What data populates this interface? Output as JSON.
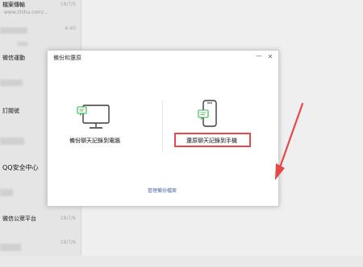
{
  "chat_list": {
    "items": [
      {
        "name": "檔案傳輸",
        "preview": "",
        "time": "18/7/5"
      },
      {
        "name": "",
        "preview": "www.zhihu.com/...",
        "time": ""
      },
      {
        "name": "",
        "preview": "",
        "time": "6:40"
      },
      {
        "name": "微信運動",
        "preview": "",
        "time": "18"
      },
      {
        "name": "",
        "preview": "",
        "time": ""
      },
      {
        "name": "訂閱號",
        "preview": "",
        "time": ""
      },
      {
        "name": "",
        "preview": "",
        "time": ""
      },
      {
        "name": "QQ安全中心",
        "preview": "",
        "time": ""
      },
      {
        "name": "",
        "preview": "",
        "time": ""
      },
      {
        "name": "微信公眾平台",
        "preview": "",
        "time": "18/7/6"
      },
      {
        "name": "",
        "preview": "",
        "time": "18/7/6"
      }
    ]
  },
  "dialog": {
    "title": "備份和還原",
    "minimize": "—",
    "close": "✕",
    "option_pc_label": "備份聊天記錄到電腦",
    "option_phone_label": "還原聊天記錄到手機",
    "manage_link": "管理備份檔案"
  },
  "colors": {
    "highlight": "#e54848",
    "link": "#4a6aa8",
    "icon": "#3a3a3a",
    "icon_bubble": "#37b44a"
  },
  "icons": {
    "pc": "monitor-icon",
    "phone": "phone-icon"
  }
}
